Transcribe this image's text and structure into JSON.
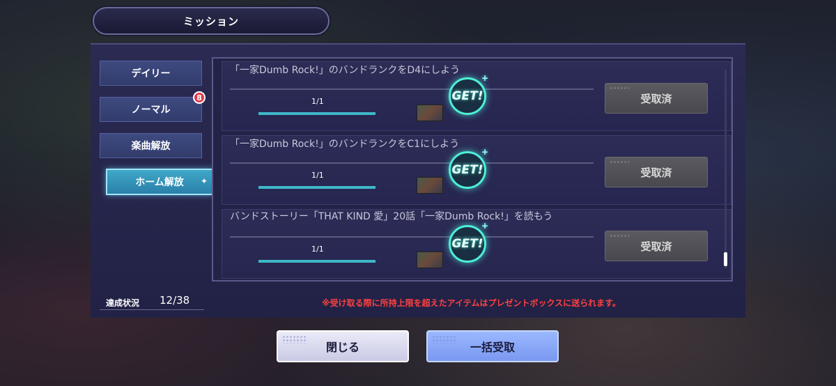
{
  "title": "ミッション",
  "tabs": [
    {
      "label": "デイリー"
    },
    {
      "label": "ノーマル",
      "badge": "8"
    },
    {
      "label": "楽曲解放"
    },
    {
      "label": "ホーム解放",
      "active": true
    }
  ],
  "missions": [
    {
      "text": "「一家Dumb Rock!」のバンドランクをD4にしよう",
      "count": "1/1",
      "progress": 1.0,
      "stamp": "GET!",
      "button": "受取済"
    },
    {
      "text": "「一家Dumb Rock!」のバンドランクをC1にしよう",
      "count": "1/1",
      "progress": 1.0,
      "stamp": "GET!",
      "button": "受取済"
    },
    {
      "text": "バンドストーリー「THAT KIND 愛」20話「一家Dumb Rock!」を読もう",
      "count": "1/1",
      "progress": 1.0,
      "stamp": "GET!",
      "button": "受取済"
    }
  ],
  "status": {
    "label": "達成状況",
    "value": "12/38"
  },
  "notice": "※受け取る際に所持上限を超えたアイテムはプレゼントボックスに送られます。",
  "buttons": {
    "close": "閉じる",
    "claim_all": "一括受取"
  },
  "colors": {
    "accent": "#4ef0d8",
    "notice": "#ff4040",
    "panel": "#2a2a52"
  }
}
